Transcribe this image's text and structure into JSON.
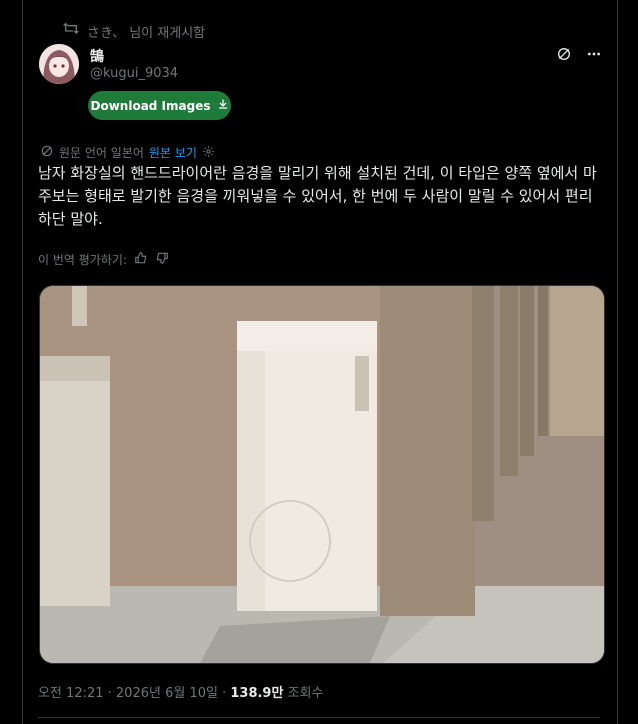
{
  "repost": {
    "text": "さき、 님이 재게시함",
    "icon": "repost-icon"
  },
  "author": {
    "display_name": "鵠",
    "handle": "@kugui_9034"
  },
  "actions": {
    "grok_icon": "grok-icon",
    "more_icon": "more-icon"
  },
  "download": {
    "label": "Download Images",
    "icon": "download-icon",
    "color": "#1e7b3a"
  },
  "translation": {
    "source_text": "원문 언어 일본어",
    "show_original": "원본 보기",
    "settings_icon": "gear-icon"
  },
  "tweet": {
    "text": "남자 화장실의 핸드드라이어란 음경을 말리기 위해 설치된 건데, 이 타입은 양쪽 옆에서 마주보는 형태로 발기한 음경을 끼워넣을 수 있어서, 한 번에 두 사람이 말릴 수 있어서 편리하단 말야."
  },
  "rating": {
    "text": "이 번역 평가하기:"
  },
  "meta": {
    "time": "오전 12:21 · 2026년 6월 10일 · ",
    "views": "138.9만",
    "views_label": " 조회수"
  },
  "colors": {
    "background": "#000000",
    "text": "#e7e9ea",
    "muted": "#71767b",
    "link": "#1d9bf0"
  }
}
